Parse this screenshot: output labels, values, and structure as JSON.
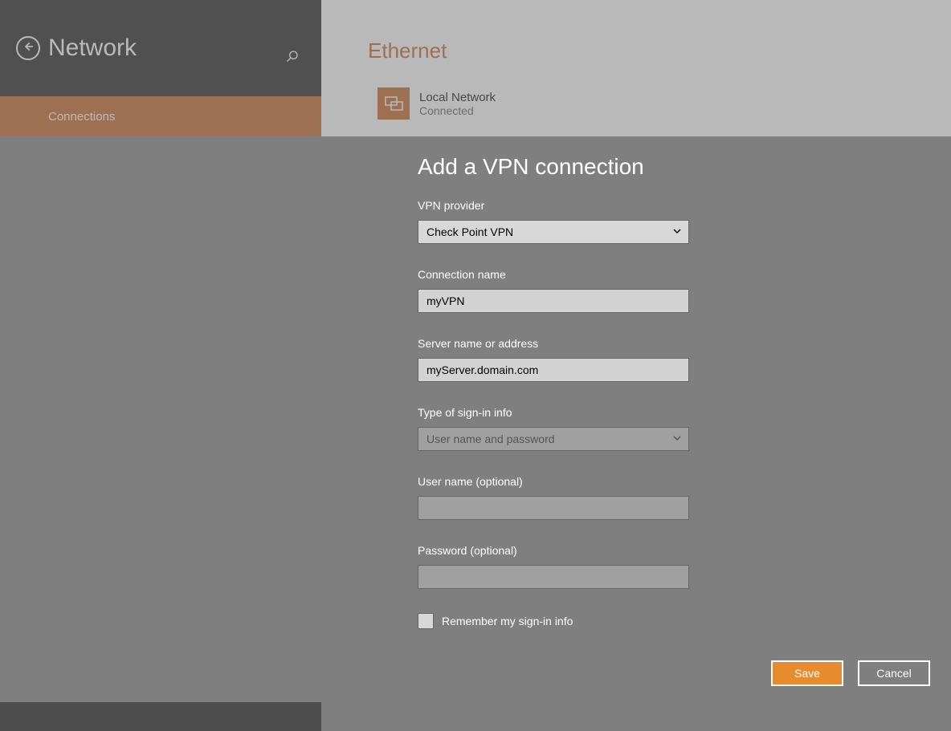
{
  "sidebar": {
    "title": "Network",
    "items": [
      {
        "label": "Connections"
      }
    ]
  },
  "main": {
    "section_title": "Ethernet",
    "network": {
      "name": "Local Network",
      "status": "Connected"
    }
  },
  "modal": {
    "title": "Add a VPN connection",
    "fields": {
      "vpn_provider_label": "VPN provider",
      "vpn_provider_value": "Check Point VPN",
      "connection_name_label": "Connection name",
      "connection_name_value": "myVPN",
      "server_label": "Server name or address",
      "server_value": "myServer.domain.com",
      "signin_type_label": "Type of sign-in info",
      "signin_type_value": "User name and password",
      "username_label": "User name (optional)",
      "username_value": "",
      "password_label": "Password (optional)",
      "password_value": "",
      "remember_label": "Remember my sign-in info",
      "remember_checked": false
    },
    "buttons": {
      "save": "Save",
      "cancel": "Cancel"
    }
  }
}
